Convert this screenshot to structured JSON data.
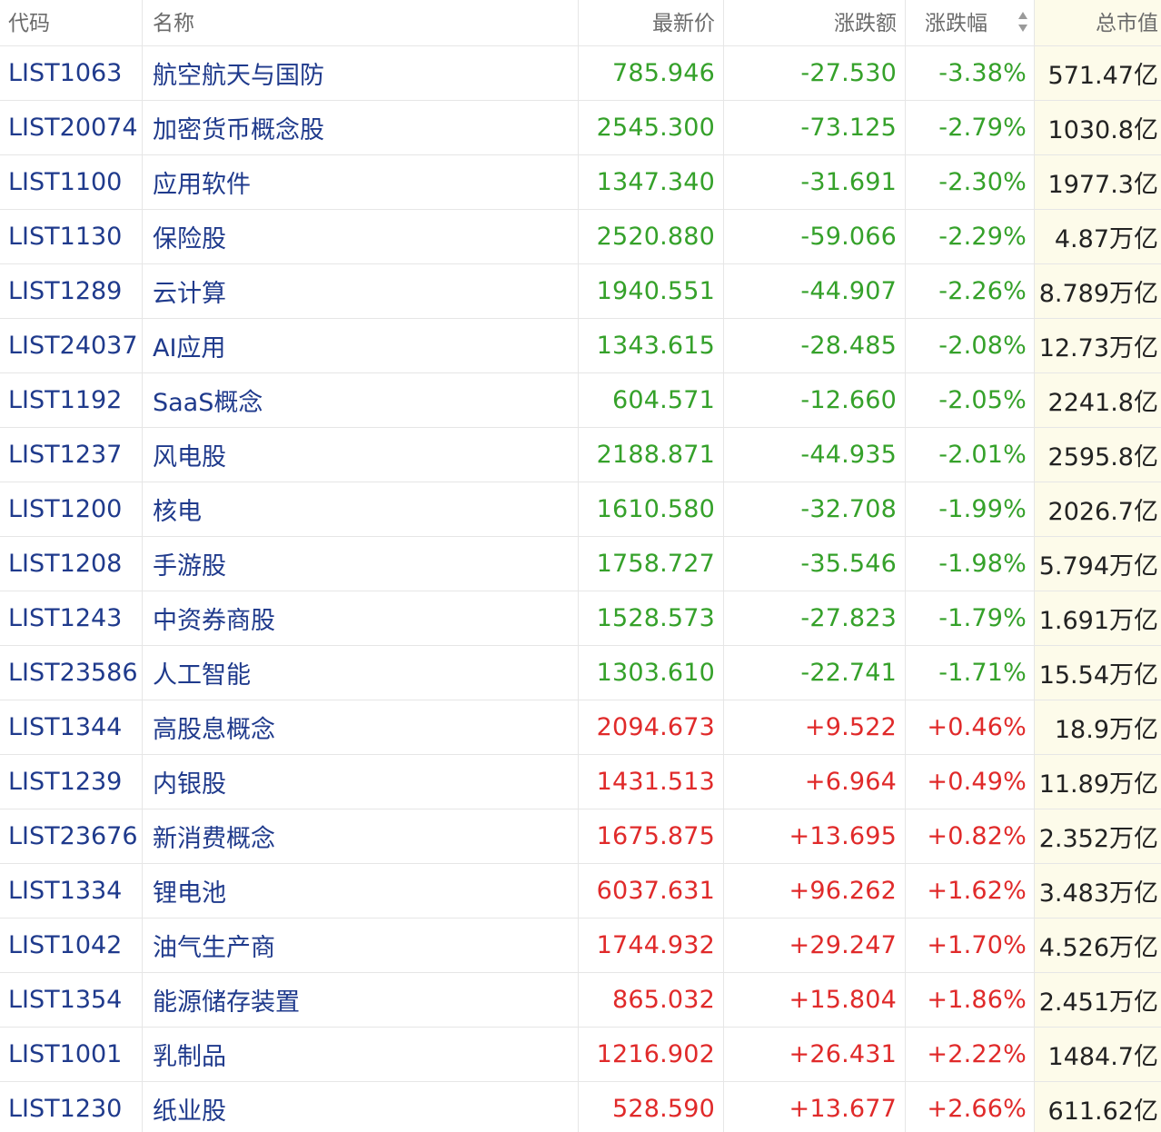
{
  "colors": {
    "down": "#35a12a",
    "up": "#e02a2a",
    "link": "#1f3a8c",
    "header_text": "#6b6b6b",
    "cap_bg": "#fdfbea"
  },
  "header": {
    "code": "代码",
    "name": "名称",
    "price": "最新价",
    "change": "涨跌额",
    "pct": "涨跌幅",
    "cap": "总市值",
    "sort_icon": "sort-up-down-icon"
  },
  "rows": [
    {
      "code": "LIST1063",
      "name": "航空航天与国防",
      "price": "785.946",
      "change": "-27.530",
      "pct": "-3.38%",
      "cap": "571.47亿",
      "dir": "down"
    },
    {
      "code": "LIST20074",
      "name": "加密货币概念股",
      "price": "2545.300",
      "change": "-73.125",
      "pct": "-2.79%",
      "cap": "1030.8亿",
      "dir": "down"
    },
    {
      "code": "LIST1100",
      "name": "应用软件",
      "price": "1347.340",
      "change": "-31.691",
      "pct": "-2.30%",
      "cap": "1977.3亿",
      "dir": "down"
    },
    {
      "code": "LIST1130",
      "name": "保险股",
      "price": "2520.880",
      "change": "-59.066",
      "pct": "-2.29%",
      "cap": "4.87万亿",
      "dir": "down"
    },
    {
      "code": "LIST1289",
      "name": "云计算",
      "price": "1940.551",
      "change": "-44.907",
      "pct": "-2.26%",
      "cap": "8.789万亿",
      "dir": "down"
    },
    {
      "code": "LIST24037",
      "name": "AI应用",
      "price": "1343.615",
      "change": "-28.485",
      "pct": "-2.08%",
      "cap": "12.73万亿",
      "dir": "down"
    },
    {
      "code": "LIST1192",
      "name": "SaaS概念",
      "price": "604.571",
      "change": "-12.660",
      "pct": "-2.05%",
      "cap": "2241.8亿",
      "dir": "down"
    },
    {
      "code": "LIST1237",
      "name": "风电股",
      "price": "2188.871",
      "change": "-44.935",
      "pct": "-2.01%",
      "cap": "2595.8亿",
      "dir": "down"
    },
    {
      "code": "LIST1200",
      "name": "核电",
      "price": "1610.580",
      "change": "-32.708",
      "pct": "-1.99%",
      "cap": "2026.7亿",
      "dir": "down"
    },
    {
      "code": "LIST1208",
      "name": "手游股",
      "price": "1758.727",
      "change": "-35.546",
      "pct": "-1.98%",
      "cap": "5.794万亿",
      "dir": "down"
    },
    {
      "code": "LIST1243",
      "name": "中资券商股",
      "price": "1528.573",
      "change": "-27.823",
      "pct": "-1.79%",
      "cap": "1.691万亿",
      "dir": "down"
    },
    {
      "code": "LIST23586",
      "name": "人工智能",
      "price": "1303.610",
      "change": "-22.741",
      "pct": "-1.71%",
      "cap": "15.54万亿",
      "dir": "down"
    },
    {
      "code": "LIST1344",
      "name": "高股息概念",
      "price": "2094.673",
      "change": "+9.522",
      "pct": "+0.46%",
      "cap": "18.9万亿",
      "dir": "up"
    },
    {
      "code": "LIST1239",
      "name": "内银股",
      "price": "1431.513",
      "change": "+6.964",
      "pct": "+0.49%",
      "cap": "11.89万亿",
      "dir": "up"
    },
    {
      "code": "LIST23676",
      "name": "新消费概念",
      "price": "1675.875",
      "change": "+13.695",
      "pct": "+0.82%",
      "cap": "2.352万亿",
      "dir": "up"
    },
    {
      "code": "LIST1334",
      "name": "锂电池",
      "price": "6037.631",
      "change": "+96.262",
      "pct": "+1.62%",
      "cap": "3.483万亿",
      "dir": "up"
    },
    {
      "code": "LIST1042",
      "name": "油气生产商",
      "price": "1744.932",
      "change": "+29.247",
      "pct": "+1.70%",
      "cap": "4.526万亿",
      "dir": "up"
    },
    {
      "code": "LIST1354",
      "name": "能源储存装置",
      "price": "865.032",
      "change": "+15.804",
      "pct": "+1.86%",
      "cap": "2.451万亿",
      "dir": "up"
    },
    {
      "code": "LIST1001",
      "name": "乳制品",
      "price": "1216.902",
      "change": "+26.431",
      "pct": "+2.22%",
      "cap": "1484.7亿",
      "dir": "up"
    },
    {
      "code": "LIST1230",
      "name": "纸业股",
      "price": "528.590",
      "change": "+13.677",
      "pct": "+2.66%",
      "cap": "611.62亿",
      "dir": "up"
    }
  ]
}
